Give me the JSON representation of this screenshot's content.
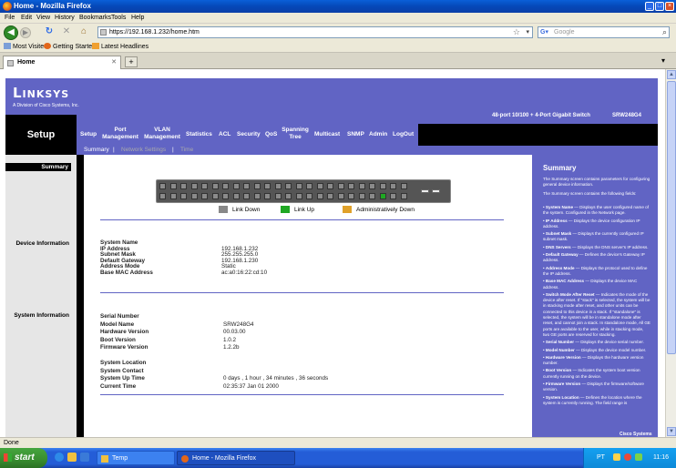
{
  "window": {
    "title": "Home - Mozilla Firefox"
  },
  "menu": [
    "File",
    "Edit",
    "View",
    "History",
    "Bookmarks",
    "Tools",
    "Help"
  ],
  "address": {
    "url": "https://192.168.1.232/home.htm"
  },
  "search": {
    "placeholder": "Google"
  },
  "bookmarks": [
    "Most Visited",
    "Getting Started",
    "Latest Headlines"
  ],
  "tab": {
    "label": "Home"
  },
  "page": {
    "brand": "Linksys",
    "brand_sub": "A Division of Cisco Systems, Inc.",
    "section": "Setup",
    "product_desc": "48-port 10/100 + 4-Port Gigabit Switch",
    "model": "SRW248G4",
    "nav": [
      "Setup",
      "Port Management",
      "VLAN Management",
      "Statistics",
      "ACL",
      "Security",
      "QoS",
      "Spanning Tree",
      "Multicast",
      "SNMP",
      "Admin",
      "LogOut"
    ],
    "subnav": {
      "current": "Summary",
      "others": [
        "Network Settings",
        "Time"
      ],
      "separator": "|"
    },
    "left": {
      "summary": "Summary",
      "device_info": "Device Information",
      "system_info": "System Information"
    },
    "legend": [
      {
        "label": "Link Down",
        "color": "#888888"
      },
      {
        "label": "Link Up",
        "color": "#1fa823"
      },
      {
        "label": "Administratively Down",
        "color": "#e0a12a"
      }
    ],
    "ports": {
      "total": 48,
      "link_up": [
        46
      ]
    },
    "device": {
      "System Name": "",
      "IP Address": "192.168.1.232",
      "Subnet Mask": "255.255.255.0",
      "Default Gateway": "192.168.1.230",
      "Address Mode": "Static",
      "Base MAC Address": "ac:a0:16:22:cd:10"
    },
    "system1": {
      "Serial Number": "",
      "Model Name": "SRW248G4",
      "Hardware Version": "00.03.00",
      "Boot Version": "1.0.2",
      "Firmware Version": "1.2.2b"
    },
    "system2": {
      "System Location": "",
      "System Contact": "",
      "System Up Time": "0 days , 1 hour , 34 minutes , 36 seconds",
      "Current Time": "02:35:37     Jan 01 2000"
    },
    "help": {
      "title": "Summary",
      "intro1": "The Summary screen contains parameters for configuring general device information.",
      "intro2": "The Summary screen contains the following fields:",
      "items": [
        {
          "term": "System Name",
          "desc": " — Displays the user configured name of the system. Configured in the Network page."
        },
        {
          "term": "IP Address",
          "desc": " — Displays the device configuration IP address."
        },
        {
          "term": "Subnet Mask",
          "desc": " — Displays the currently configured IP subnet mask."
        },
        {
          "term": "DNS Servers",
          "desc": " — Displays the DNS server's IP address."
        },
        {
          "term": "Default Gateway",
          "desc": " — Defines the device's Gateway IP address."
        },
        {
          "term": "Address Mode",
          "desc": " — Displays the protocol used to define the IP address."
        },
        {
          "term": "Base MAC Address",
          "desc": " — Displays the device MAC address."
        },
        {
          "term": "Switch Mode After Reset",
          "desc": " — Indicates the mode of the device after reset. If \"stack\" is selected, the system will be in stacking mode after reset, and other units can be connected to this device in a stack. If \"standalone\" is selected, the system will be in standalone mode after reset, and cannot join a stack. In standalone mode, All GE ports are available to the user, while in stacking mode, two GE ports are reserved for stacking."
        },
        {
          "term": "Serial Number",
          "desc": " — Displays the device serial number."
        },
        {
          "term": "Model Number",
          "desc": " — Displays the device model number."
        },
        {
          "term": "Hardware Version",
          "desc": " — Displays the hardware version number."
        },
        {
          "term": "Boot Version",
          "desc": " — Indicates the system boot version currently running on the device."
        },
        {
          "term": "Firmware Version",
          "desc": " — Displays the firmware/software version."
        },
        {
          "term": "System Location",
          "desc": " — Defines the location where the system is currently running. The field range is"
        }
      ],
      "footer": "Cisco Systems"
    }
  },
  "status": {
    "text": "Done"
  },
  "taskbar": {
    "start": "start",
    "tasks": [
      "Temp",
      "Home - Mozilla Firefox"
    ],
    "lang": "PT",
    "clock": "11:16"
  }
}
